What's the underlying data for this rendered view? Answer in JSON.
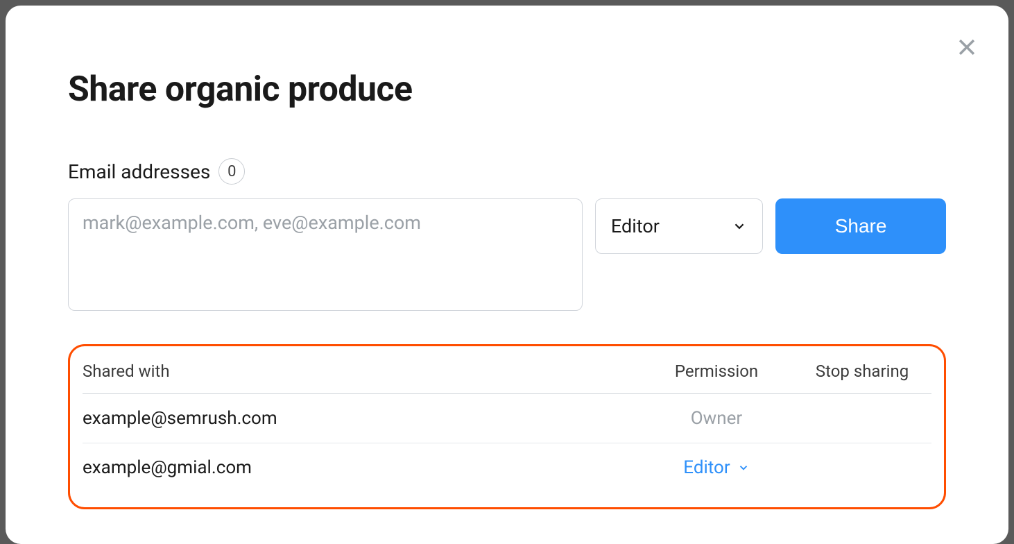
{
  "modal": {
    "title": "Share organic produce",
    "email_label": "Email addresses",
    "email_count": "0",
    "email_placeholder": "mark@example.com, eve@example.com",
    "role_selected": "Editor",
    "share_button": "Share"
  },
  "table": {
    "headers": {
      "shared_with": "Shared with",
      "permission": "Permission",
      "stop_sharing": "Stop sharing"
    },
    "rows": [
      {
        "email": "example@semrush.com",
        "permission": "Owner",
        "editable": false,
        "removable": false
      },
      {
        "email": "example@gmial.com",
        "permission": "Editor",
        "editable": true,
        "removable": true
      }
    ]
  }
}
